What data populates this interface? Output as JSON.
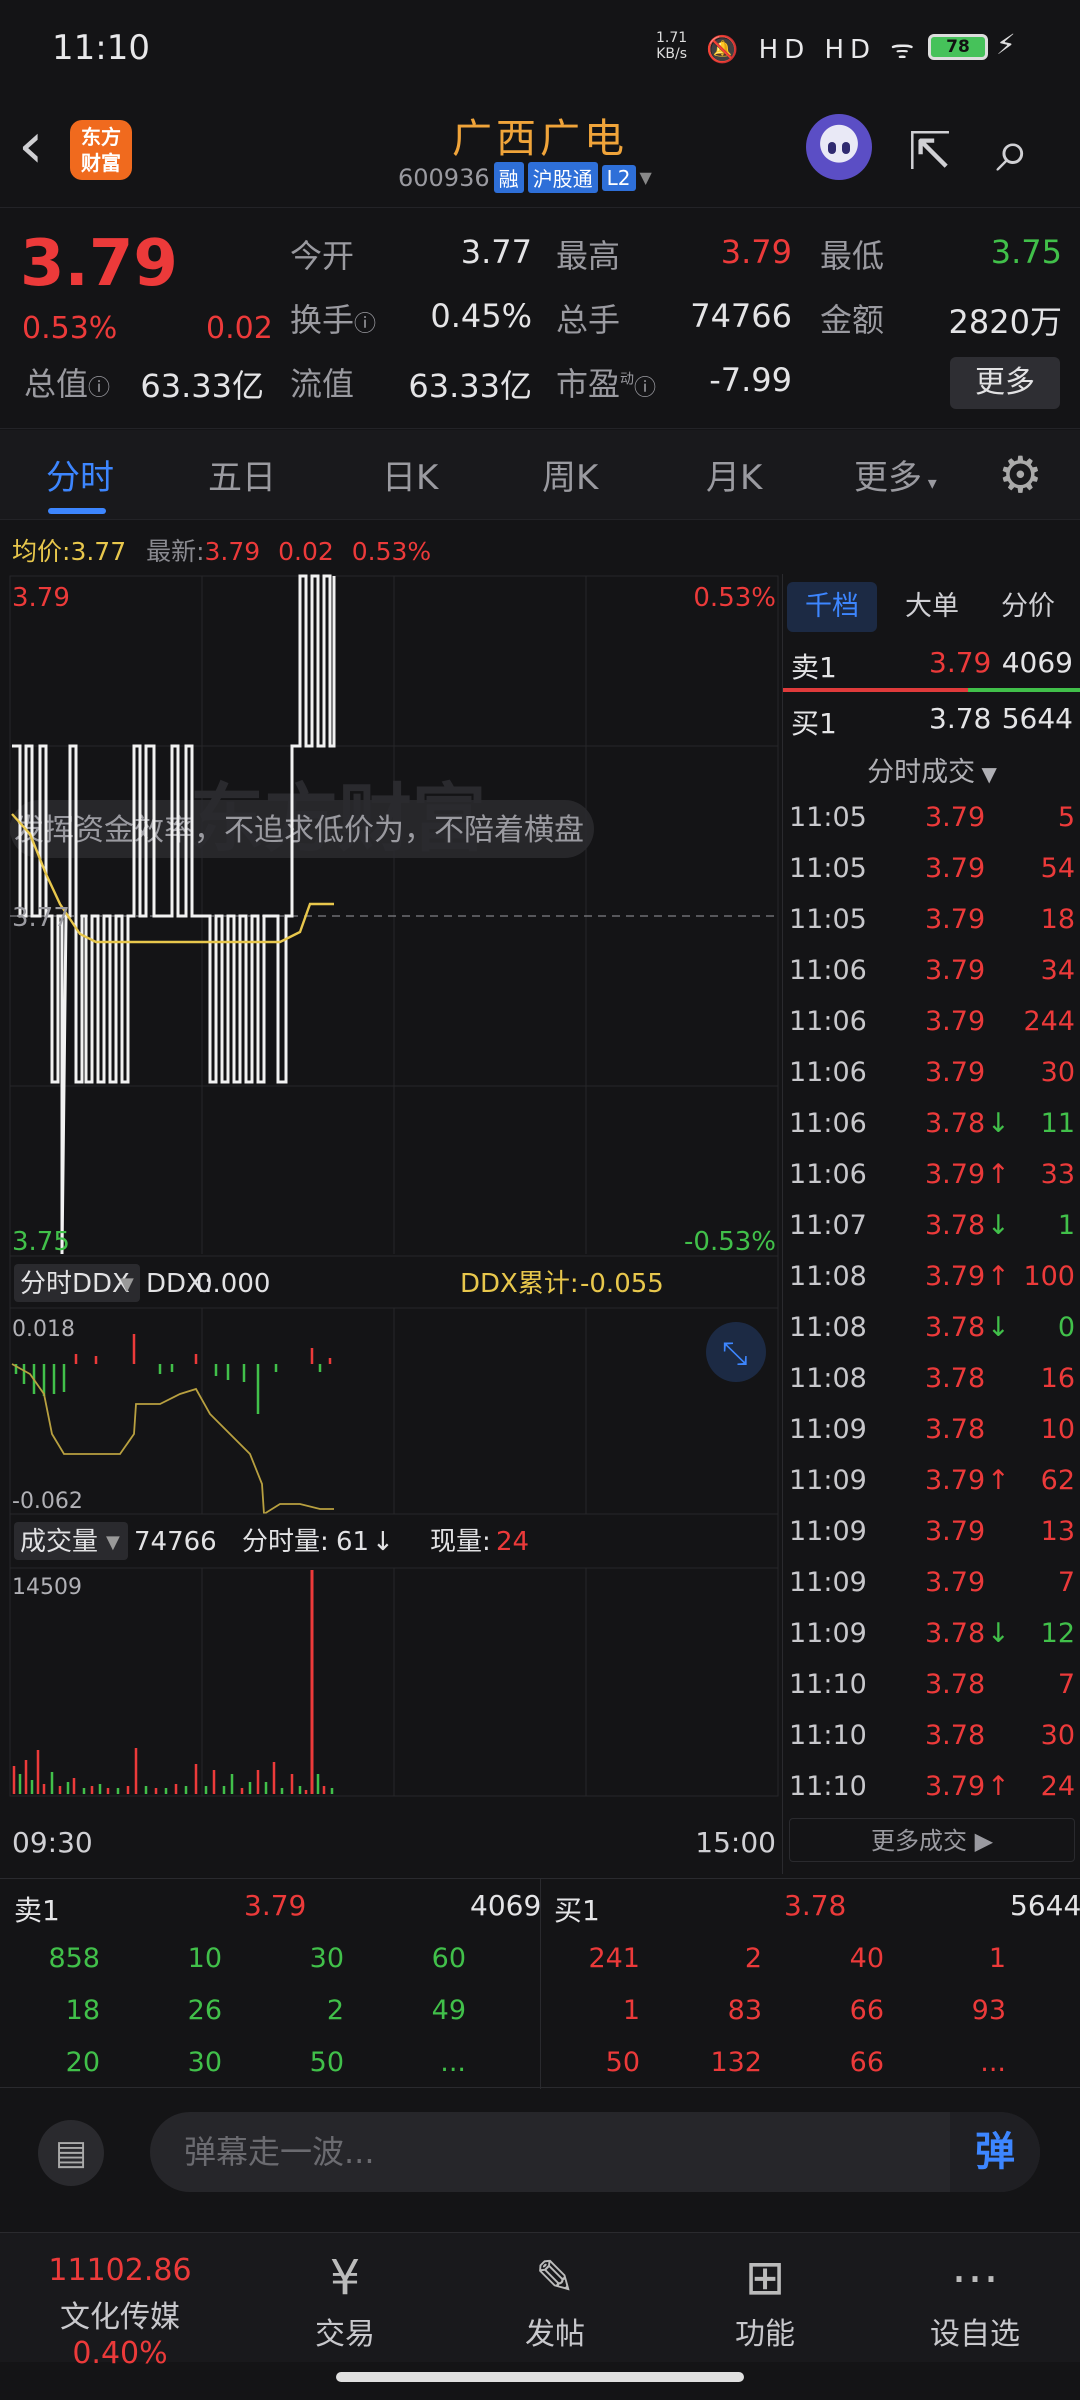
{
  "status_bar": {
    "time": "11:10",
    "net_speed": "1.71",
    "net_unit": "KB/s",
    "signal_icons": "HD HD",
    "battery": "78"
  },
  "header": {
    "stock_name": "广西广电",
    "code": "600936",
    "tags": [
      "融",
      "沪股通",
      "L2"
    ],
    "logo_text": "东方财富"
  },
  "quote": {
    "price": "3.79",
    "pct": "0.53%",
    "change": "0.02",
    "open_label": "今开",
    "open": "3.77",
    "high_label": "最高",
    "high": "3.79",
    "low_label": "最低",
    "low": "3.75",
    "turnover_label": "换手",
    "turnover": "0.45%",
    "volume_label": "总手",
    "volume": "74766",
    "amount_label": "金额",
    "amount": "2820万",
    "mktcap_label": "总值",
    "mktcap": "63.33亿",
    "float_label": "流值",
    "float": "63.33亿",
    "pe_label": "市盈",
    "pe_sup": "动",
    "pe": "-7.99",
    "more_button": "更多"
  },
  "tabs": [
    "分时",
    "五日",
    "日K",
    "周K",
    "月K",
    "更多"
  ],
  "avg_line": {
    "avg_label": "均价:",
    "avg": "3.77",
    "latest_label": "最新:",
    "latest": "3.79",
    "change": "0.02",
    "pct": "0.53%"
  },
  "intraday": {
    "top_price": "3.79",
    "bottom_price": "3.75",
    "top_pct": "0.53%",
    "bottom_pct": "-0.53%",
    "ref_price": "3.77",
    "watermark": "东方财富",
    "banner": "发挥资金效率，不追求低价为，不陪着横盘"
  },
  "ddx": {
    "selector": "分时DDX",
    "ddx_label": "DDX:",
    "ddx_value": "0.000",
    "cum_label": "DDX累计:",
    "cum_value": "-0.055",
    "top": "0.018",
    "bottom": "-0.062"
  },
  "volume": {
    "selector": "成交量",
    "total": "74766",
    "minute_label": "分时量:",
    "minute_value": "61",
    "minute_arrow": "↓",
    "now_label": "现量:",
    "now_value": "24",
    "top": "14509",
    "start_time": "09:30",
    "end_time": "15:00"
  },
  "right_panel": {
    "segments": [
      "千档",
      "大单",
      "分价"
    ],
    "sell1": {
      "label": "卖1",
      "price": "3.79",
      "qty": "4069"
    },
    "buy1": {
      "label": "买1",
      "price": "3.78",
      "qty": "5644"
    },
    "trades_header": "分时成交",
    "trades": [
      {
        "time": "11:05",
        "price": "3.79",
        "arrow": "",
        "qty": "5"
      },
      {
        "time": "11:05",
        "price": "3.79",
        "arrow": "",
        "qty": "54"
      },
      {
        "time": "11:05",
        "price": "3.79",
        "arrow": "",
        "qty": "18"
      },
      {
        "time": "11:06",
        "price": "3.79",
        "arrow": "",
        "qty": "34"
      },
      {
        "time": "11:06",
        "price": "3.79",
        "arrow": "",
        "qty": "244"
      },
      {
        "time": "11:06",
        "price": "3.79",
        "arrow": "",
        "qty": "30"
      },
      {
        "time": "11:06",
        "price": "3.78",
        "arrow": "↓",
        "qty": "11"
      },
      {
        "time": "11:06",
        "price": "3.79",
        "arrow": "↑",
        "qty": "33"
      },
      {
        "time": "11:07",
        "price": "3.78",
        "arrow": "↓",
        "qty": "1"
      },
      {
        "time": "11:08",
        "price": "3.79",
        "arrow": "↑",
        "qty": "100"
      },
      {
        "time": "11:08",
        "price": "3.78",
        "arrow": "↓",
        "qty": "0"
      },
      {
        "time": "11:08",
        "price": "3.78",
        "arrow": "",
        "qty": "16"
      },
      {
        "time": "11:09",
        "price": "3.78",
        "arrow": "",
        "qty": "10"
      },
      {
        "time": "11:09",
        "price": "3.79",
        "arrow": "↑",
        "qty": "62"
      },
      {
        "time": "11:09",
        "price": "3.79",
        "arrow": "",
        "qty": "13"
      },
      {
        "time": "11:09",
        "price": "3.79",
        "arrow": "",
        "qty": "7"
      },
      {
        "time": "11:09",
        "price": "3.78",
        "arrow": "↓",
        "qty": "12"
      },
      {
        "time": "11:10",
        "price": "3.78",
        "arrow": "",
        "qty": "7"
      },
      {
        "time": "11:10",
        "price": "3.78",
        "arrow": "",
        "qty": "30"
      },
      {
        "time": "11:10",
        "price": "3.79",
        "arrow": "↑",
        "qty": "24"
      }
    ],
    "more_trades": "更多成交"
  },
  "order_book": {
    "sell": {
      "label": "卖1",
      "price": "3.79",
      "qty": "4069",
      "rows": [
        [
          "858",
          "10",
          "30",
          "60"
        ],
        [
          "18",
          "26",
          "2",
          "49"
        ],
        [
          "20",
          "30",
          "50",
          "..."
        ]
      ]
    },
    "buy": {
      "label": "买1",
      "price": "3.78",
      "qty": "5644",
      "rows": [
        [
          "241",
          "2",
          "40",
          "1"
        ],
        [
          "1",
          "83",
          "66",
          "93"
        ],
        [
          "50",
          "132",
          "66",
          "..."
        ]
      ]
    }
  },
  "danmu": {
    "placeholder": "弹幕走一波...",
    "send": "弹"
  },
  "bottom_nav": {
    "index_value": "11102.86",
    "index_name": "文化传媒",
    "index_pct": "0.40%",
    "items": [
      {
        "label": "交易",
        "icon": "yen-cycle-icon"
      },
      {
        "label": "发帖",
        "icon": "edit-icon"
      },
      {
        "label": "功能",
        "icon": "grid-icon"
      },
      {
        "label": "设自选",
        "icon": "more-icon"
      }
    ]
  },
  "colors": {
    "up": "#ec3a3a",
    "down": "#41c04a",
    "accent": "#3d86ff",
    "avg": "#e8c74c",
    "price_line": "#f2f2f2"
  }
}
